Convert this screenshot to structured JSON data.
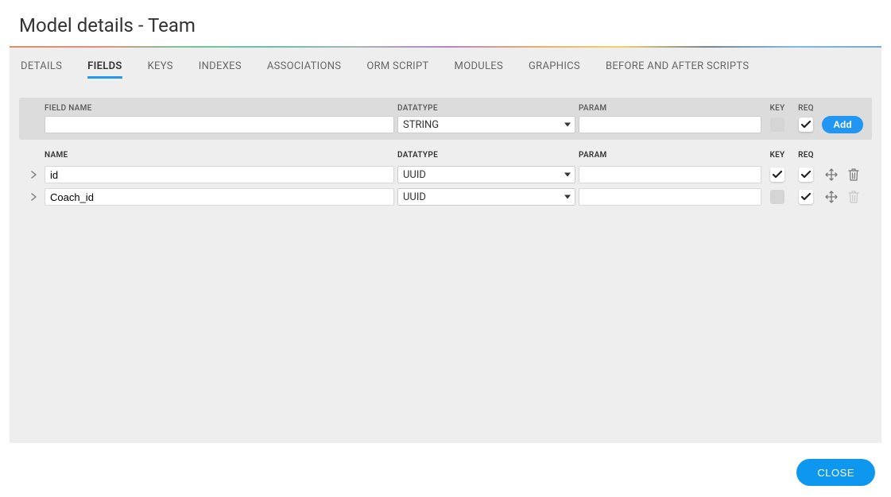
{
  "title": "Model details - Team",
  "tabs": [
    {
      "label": "DETAILS",
      "active": false
    },
    {
      "label": "FIELDS",
      "active": true
    },
    {
      "label": "KEYS",
      "active": false
    },
    {
      "label": "INDEXES",
      "active": false
    },
    {
      "label": "ASSOCIATIONS",
      "active": false
    },
    {
      "label": "ORM SCRIPT",
      "active": false
    },
    {
      "label": "MODULES",
      "active": false
    },
    {
      "label": "GRAPHICS",
      "active": false
    },
    {
      "label": "BEFORE AND AFTER SCRIPTS",
      "active": false
    }
  ],
  "newFieldHeader": {
    "fieldName": "FIELD NAME",
    "datatype": "DATATYPE",
    "param": "PARAM",
    "key": "KEY",
    "req": "REQ"
  },
  "newField": {
    "name": "",
    "datatype": "STRING",
    "param": "",
    "key": false,
    "req": true,
    "addLabel": "Add"
  },
  "listHeader": {
    "name": "NAME",
    "datatype": "DATATYPE",
    "param": "PARAM",
    "key": "KEY",
    "req": "REQ"
  },
  "fields": [
    {
      "name": "id",
      "datatype": "UUID",
      "param": "",
      "key": true,
      "req": true,
      "deletable": true
    },
    {
      "name": "Coach_id",
      "datatype": "UUID",
      "param": "",
      "key": false,
      "req": true,
      "deletable": false
    }
  ],
  "footer": {
    "closeLabel": "CLOSE"
  }
}
